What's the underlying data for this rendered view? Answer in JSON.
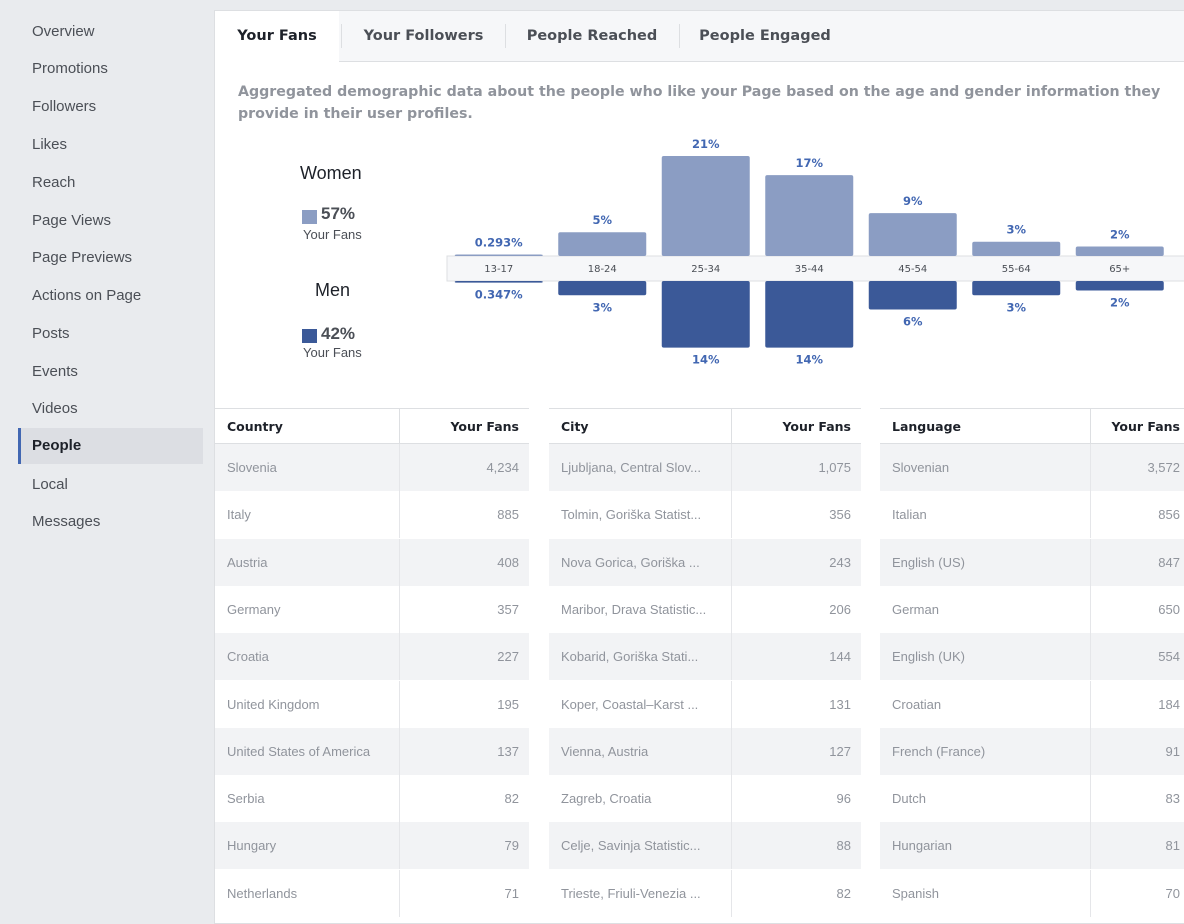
{
  "sidebar": {
    "items": [
      {
        "label": "Overview"
      },
      {
        "label": "Promotions"
      },
      {
        "label": "Followers"
      },
      {
        "label": "Likes"
      },
      {
        "label": "Reach"
      },
      {
        "label": "Page Views"
      },
      {
        "label": "Page Previews"
      },
      {
        "label": "Actions on Page"
      },
      {
        "label": "Posts"
      },
      {
        "label": "Events"
      },
      {
        "label": "Videos"
      },
      {
        "label": "People",
        "active": true
      },
      {
        "label": "Local"
      },
      {
        "label": "Messages"
      }
    ]
  },
  "tabs": [
    {
      "label": "Your Fans",
      "active": true
    },
    {
      "label": "Your Followers"
    },
    {
      "label": "People Reached"
    },
    {
      "label": "People Engaged"
    }
  ],
  "description": "Aggregated demographic data about the people who like your Page based on the age and gender information they provide in their user profiles.",
  "gender": {
    "women": {
      "title": "Women",
      "pct": "57%",
      "sub": "Your Fans"
    },
    "men": {
      "title": "Men",
      "pct": "42%",
      "sub": "Your Fans"
    }
  },
  "colors": {
    "women": "#8b9dc3",
    "men": "#3b5998",
    "label": "#4267b2"
  },
  "chart_data": {
    "type": "bar",
    "categories": [
      "13-17",
      "18-24",
      "25-34",
      "35-44",
      "45-54",
      "55-64",
      "65+"
    ],
    "series": [
      {
        "name": "Women",
        "values": [
          0.293,
          5,
          21,
          17,
          9,
          3,
          2
        ],
        "labels": [
          "0.293%",
          "5%",
          "21%",
          "17%",
          "9%",
          "3%",
          "2%"
        ]
      },
      {
        "name": "Men",
        "values": [
          0.347,
          3,
          14,
          14,
          6,
          3,
          2
        ],
        "labels": [
          "0.347%",
          "3%",
          "14%",
          "14%",
          "6%",
          "3%",
          "2%"
        ]
      }
    ]
  },
  "tables": {
    "country": {
      "col1": "Country",
      "col2": "Your Fans",
      "rows": [
        [
          "Slovenia",
          "4,234"
        ],
        [
          "Italy",
          "885"
        ],
        [
          "Austria",
          "408"
        ],
        [
          "Germany",
          "357"
        ],
        [
          "Croatia",
          "227"
        ],
        [
          "United Kingdom",
          "195"
        ],
        [
          "United States of America",
          "137"
        ],
        [
          "Serbia",
          "82"
        ],
        [
          "Hungary",
          "79"
        ],
        [
          "Netherlands",
          "71"
        ]
      ]
    },
    "city": {
      "col1": "City",
      "col2": "Your Fans",
      "rows": [
        [
          "Ljubljana, Central Slov...",
          "1,075"
        ],
        [
          "Tolmin, Goriška Statist...",
          "356"
        ],
        [
          "Nova Gorica, Goriška ...",
          "243"
        ],
        [
          "Maribor, Drava Statistic...",
          "206"
        ],
        [
          "Kobarid, Goriška Stati...",
          "144"
        ],
        [
          "Koper, Coastal–Karst ...",
          "131"
        ],
        [
          "Vienna, Austria",
          "127"
        ],
        [
          "Zagreb, Croatia",
          "96"
        ],
        [
          "Celje, Savinja Statistic...",
          "88"
        ],
        [
          "Trieste, Friuli-Venezia ...",
          "82"
        ]
      ]
    },
    "language": {
      "col1": "Language",
      "col2": "Your Fans",
      "rows": [
        [
          "Slovenian",
          "3,572"
        ],
        [
          "Italian",
          "856"
        ],
        [
          "English (US)",
          "847"
        ],
        [
          "German",
          "650"
        ],
        [
          "English (UK)",
          "554"
        ],
        [
          "Croatian",
          "184"
        ],
        [
          "French (France)",
          "91"
        ],
        [
          "Dutch",
          "83"
        ],
        [
          "Hungarian",
          "81"
        ],
        [
          "Spanish",
          "70"
        ]
      ]
    }
  }
}
